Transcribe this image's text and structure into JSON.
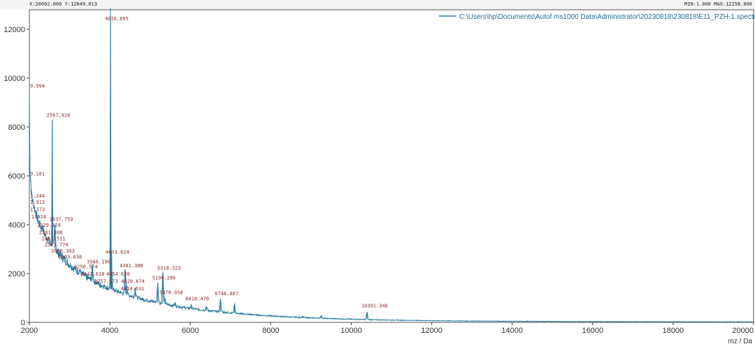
{
  "header": {
    "coord_readout": "X:20002.000  Y:12849.013",
    "range_readout": "MIN:1.000  MAX:12258.000"
  },
  "colors": {
    "spectrum": "#2e7aa0",
    "peak_label": "#8b2a2a",
    "axis": "#444444"
  },
  "chart_data": {
    "type": "line",
    "xlabel": "mz / Da",
    "ylabel": "",
    "xlim": [
      2000,
      20000
    ],
    "ylim": [
      0,
      12800
    ],
    "grid": false,
    "legend_position": "top-right",
    "x_ticks": [
      2000,
      4000,
      6000,
      8000,
      10000,
      12000,
      14000,
      16000,
      18000,
      20000
    ],
    "y_ticks": [
      0,
      2000,
      4000,
      6000,
      8000,
      10000,
      12000
    ],
    "series": [
      {
        "name": "C:\\Users\\hp\\Documents\\Autof ms1000 Data\\Administrator\\20230818\\230818\\E11_PZH-1.spectrum",
        "baseline": [
          [
            2000,
            6800
          ],
          [
            2020,
            6000
          ],
          [
            2050,
            5300
          ],
          [
            2100,
            4800
          ],
          [
            2150,
            4500
          ],
          [
            2200,
            4250
          ],
          [
            2300,
            3850
          ],
          [
            2400,
            3550
          ],
          [
            2500,
            3300
          ],
          [
            2600,
            3080
          ],
          [
            2700,
            2880
          ],
          [
            2800,
            2700
          ],
          [
            2900,
            2530
          ],
          [
            3000,
            2370
          ],
          [
            3200,
            2100
          ],
          [
            3400,
            1880
          ],
          [
            3600,
            1680
          ],
          [
            3800,
            1520
          ],
          [
            4000,
            1380
          ],
          [
            4200,
            1260
          ],
          [
            4400,
            1150
          ],
          [
            4600,
            1050
          ],
          [
            4800,
            960
          ],
          [
            5000,
            880
          ],
          [
            5200,
            810
          ],
          [
            5400,
            740
          ],
          [
            5600,
            680
          ],
          [
            5800,
            620
          ],
          [
            6000,
            570
          ],
          [
            6400,
            490
          ],
          [
            6800,
            420
          ],
          [
            7200,
            360
          ],
          [
            7600,
            310
          ],
          [
            8000,
            265
          ],
          [
            8500,
            220
          ],
          [
            9000,
            185
          ],
          [
            9500,
            155
          ],
          [
            10000,
            130
          ],
          [
            11000,
            95
          ],
          [
            12000,
            70
          ],
          [
            13000,
            55
          ],
          [
            14000,
            45
          ],
          [
            15000,
            38
          ],
          [
            16000,
            32
          ],
          [
            17000,
            28
          ],
          [
            18000,
            25
          ],
          [
            19000,
            22
          ],
          [
            20000,
            20
          ]
        ],
        "peaks": [
          {
            "mz": 2000,
            "intensity": 9500
          },
          {
            "mz": 2030,
            "intensity": 5900
          },
          {
            "mz": 2070,
            "intensity": 5000
          },
          {
            "mz": 2110,
            "intensity": 4800
          },
          {
            "mz": 2150,
            "intensity": 4550
          },
          {
            "mz": 2190,
            "intensity": 4300
          },
          {
            "mz": 2330,
            "intensity": 3900
          },
          {
            "mz": 2380,
            "intensity": 3600
          },
          {
            "mz": 2450,
            "intensity": 3300
          },
          {
            "mz": 2520,
            "intensity": 3150
          },
          {
            "mz": 2567.92,
            "intensity": 8300
          },
          {
            "mz": 2637,
            "intensity": 4000
          },
          {
            "mz": 2680,
            "intensity": 2800
          },
          {
            "mz": 2860,
            "intensity": 2600
          },
          {
            "mz": 3250,
            "intensity": 2150
          },
          {
            "mz": 3420,
            "intensity": 1750
          },
          {
            "mz": 3530,
            "intensity": 1700
          },
          {
            "mz": 3566,
            "intensity": 2300
          },
          {
            "mz": 3757,
            "intensity": 1400
          },
          {
            "mz": 4016.895,
            "intensity": 12258
          },
          {
            "mz": 4033,
            "intensity": 2700
          },
          {
            "mz": 4050,
            "intensity": 1750
          },
          {
            "mz": 4381,
            "intensity": 2150
          },
          {
            "mz": 4420,
            "intensity": 1500
          },
          {
            "mz": 4410,
            "intensity": 1200
          },
          {
            "mz": 4630,
            "intensity": 1400
          },
          {
            "mz": 5190,
            "intensity": 1600
          },
          {
            "mz": 5318,
            "intensity": 2050
          },
          {
            "mz": 5370,
            "intensity": 950
          },
          {
            "mz": 5620,
            "intensity": 800
          },
          {
            "mz": 6018,
            "intensity": 700
          },
          {
            "mz": 6400,
            "intensity": 650
          },
          {
            "mz": 6748,
            "intensity": 950
          },
          {
            "mz": 7100,
            "intensity": 750
          },
          {
            "mz": 8800,
            "intensity": 250
          },
          {
            "mz": 9250,
            "intensity": 270
          },
          {
            "mz": 10391.346,
            "intensity": 420
          }
        ]
      }
    ],
    "annotations": [
      {
        "text": "9.994",
        "mz": 2000,
        "intensity": 9500
      },
      {
        "text": "2567.920",
        "mz": 2567.92,
        "intensity": 8300
      },
      {
        "text": "4016.895",
        "mz": 4016.895,
        "intensity": 12258
      },
      {
        "text": "3.181",
        "mz": 2030,
        "intensity": 5900
      },
      {
        "text": "1.244",
        "mz": 2070,
        "intensity": 5000
      },
      {
        "text": "1.913",
        "mz": 2110,
        "intensity": 4750
      },
      {
        "text": "1.373",
        "mz": 2150,
        "intensity": 4450
      },
      {
        "text": "1.324",
        "mz": 2190,
        "intensity": 4150
      },
      {
        "text": "2637.759",
        "mz": 2637,
        "intensity": 4050
      },
      {
        "text": "2329.124",
        "mz": 2330,
        "intensity": 3800
      },
      {
        "text": "2381.380",
        "mz": 2380,
        "intensity": 3500
      },
      {
        "text": "2451.511",
        "mz": 2450,
        "intensity": 3250
      },
      {
        "text": "2521.774",
        "mz": 2520,
        "intensity": 3000
      },
      {
        "text": "2686.343",
        "mz": 2680,
        "intensity": 2750
      },
      {
        "text": "2893.038",
        "mz": 2860,
        "intensity": 2500
      },
      {
        "text": "3566.190",
        "mz": 3566,
        "intensity": 2300
      },
      {
        "text": "3250.574",
        "mz": 3250,
        "intensity": 2100
      },
      {
        "text": "3442.618",
        "mz": 3420,
        "intensity": 1800
      },
      {
        "text": "3757.673",
        "mz": 3757,
        "intensity": 1500
      },
      {
        "text": "4033.024",
        "mz": 4033,
        "intensity": 2700
      },
      {
        "text": "4054.620",
        "mz": 4050,
        "intensity": 1800
      },
      {
        "text": "4381.388",
        "mz": 4381,
        "intensity": 2150
      },
      {
        "text": "4420.674",
        "mz": 4420,
        "intensity": 1500
      },
      {
        "text": "4410.631",
        "mz": 4410,
        "intensity": 1200
      },
      {
        "text": "5318.323",
        "mz": 5318,
        "intensity": 2050
      },
      {
        "text": "5190.286",
        "mz": 5190,
        "intensity": 1650
      },
      {
        "text": "5370.058",
        "mz": 5370,
        "intensity": 1050
      },
      {
        "text": "6018.470",
        "mz": 6018,
        "intensity": 780
      },
      {
        "text": "6748.867",
        "mz": 6748,
        "intensity": 1000
      },
      {
        "text": "10391.346",
        "mz": 10391.346,
        "intensity": 500
      }
    ]
  }
}
